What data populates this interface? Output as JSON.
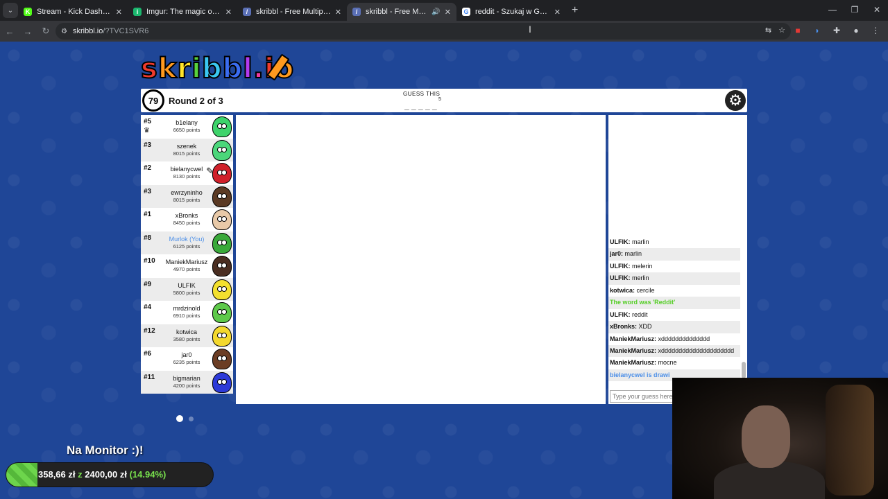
{
  "browser": {
    "tabs": [
      {
        "title": "Stream - Kick Dashboard",
        "fav_color": "#53fc18",
        "fav_char": "K",
        "active": false
      },
      {
        "title": "Imgur: The magic of the Interne",
        "fav_color": "#1bb76e",
        "fav_char": "i",
        "active": false
      },
      {
        "title": "skribbl - Free Multiplayer Drawi",
        "fav_color": "#5a6fb5",
        "fav_char": "/",
        "active": false
      },
      {
        "title": "skribbl - Free Multiplayer D",
        "fav_color": "#5a6fb5",
        "fav_char": "/",
        "active": true
      },
      {
        "title": "reddit - Szukaj w Google",
        "fav_color": "#ffffff",
        "fav_char": "G",
        "active": false
      }
    ],
    "url_host": "skribbl.io",
    "url_path": "/?TVC1SVR6"
  },
  "game": {
    "logo": "skribbl.io",
    "timer": "79",
    "round": "Round 2 of 3",
    "guess_label": "GUESS THIS",
    "word_blanks": "_ _ _ _ _",
    "word_length": "5",
    "players": [
      {
        "rank": "#5",
        "name": "b1elany",
        "points": "6650 points",
        "color": "#3ed36b",
        "you": false,
        "crown": true,
        "drawing": false
      },
      {
        "rank": "#3",
        "name": "szenek",
        "points": "8015 points",
        "color": "#4bd67a",
        "you": false,
        "crown": false,
        "drawing": false
      },
      {
        "rank": "#2",
        "name": "bielanycwel",
        "points": "8130 points",
        "color": "#d0202a",
        "you": false,
        "crown": false,
        "drawing": true
      },
      {
        "rank": "#3",
        "name": "ewrzyninho",
        "points": "8015 points",
        "color": "#5b3a24",
        "you": false,
        "crown": false,
        "drawing": false
      },
      {
        "rank": "#1",
        "name": "xBronks",
        "points": "8450 points",
        "color": "#e8c9a8",
        "you": false,
        "crown": false,
        "drawing": false
      },
      {
        "rank": "#8",
        "name": "Murlok (You)",
        "points": "6125 points",
        "color": "#3aa93a",
        "you": true,
        "crown": false,
        "drawing": false
      },
      {
        "rank": "#10",
        "name": "ManiekMariusz",
        "points": "4970 points",
        "color": "#4a2e22",
        "you": false,
        "crown": false,
        "drawing": false
      },
      {
        "rank": "#9",
        "name": "ULFIK",
        "points": "5800 points",
        "color": "#f3e02e",
        "you": false,
        "crown": false,
        "drawing": false
      },
      {
        "rank": "#4",
        "name": "mrdzinold",
        "points": "6910 points",
        "color": "#5ec94a",
        "you": false,
        "crown": false,
        "drawing": false
      },
      {
        "rank": "#12",
        "name": "kotwica",
        "points": "3580 points",
        "color": "#f3d82e",
        "you": false,
        "crown": false,
        "drawing": false
      },
      {
        "rank": "#6",
        "name": "jar0",
        "points": "6235 points",
        "color": "#6b3d24",
        "you": false,
        "crown": false,
        "drawing": false
      },
      {
        "rank": "#11",
        "name": "bigmarian",
        "points": "4200 points",
        "color": "#2d3ad8",
        "you": false,
        "crown": false,
        "drawing": false
      }
    ],
    "chat": [
      {
        "user": "ULFIK:",
        "text": "marlin",
        "type": "normal"
      },
      {
        "user": "jar0:",
        "text": "marlin",
        "type": "normal"
      },
      {
        "user": "ULFIK:",
        "text": "melerin",
        "type": "normal"
      },
      {
        "user": "ULFIK:",
        "text": "merlin",
        "type": "normal"
      },
      {
        "user": "kotwica:",
        "text": "cercile",
        "type": "normal"
      },
      {
        "user": "",
        "text": "The word was 'Reddit'",
        "type": "green"
      },
      {
        "user": "ULFIK:",
        "text": "reddit",
        "type": "normal"
      },
      {
        "user": "xBronks:",
        "text": "XDD",
        "type": "normal"
      },
      {
        "user": "ManiekMariusz:",
        "text": "xdddddddddddddd",
        "type": "normal"
      },
      {
        "user": "ManiekMariusz:",
        "text": "xddddddddddddddddddddd",
        "type": "normal"
      },
      {
        "user": "ManiekMariusz:",
        "text": "mocne",
        "type": "normal"
      },
      {
        "user": "",
        "text": "bielanycwel is drawi",
        "type": "blue"
      }
    ],
    "chat_placeholder": "Type your guess here..."
  },
  "stream_overlay": {
    "goal_title": "Na Monitor :)!",
    "goal_amount": "358,66 zł",
    "goal_sep": "z",
    "goal_target": "2400,00 zł",
    "goal_pct_text": "(14.94%)",
    "goal_fraction": 0.1494
  }
}
